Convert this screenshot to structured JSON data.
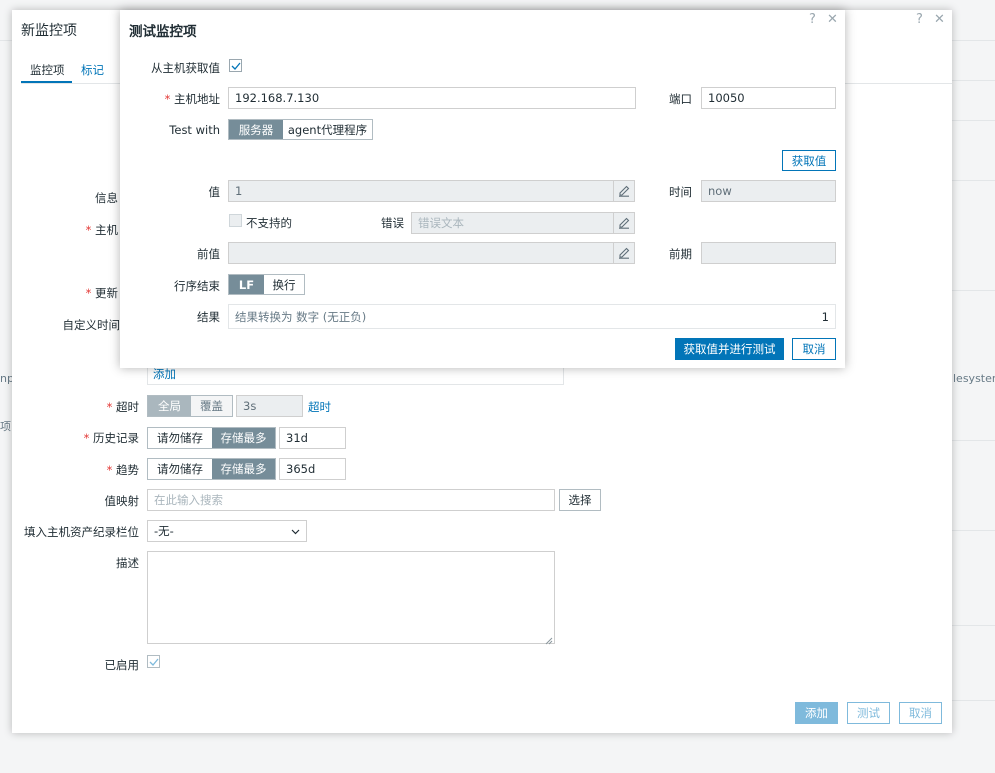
{
  "background": {
    "left_fragments": [
      "npo",
      "项"
    ],
    "right_fragment": "lesystem"
  },
  "item_dialog": {
    "title": "新监控项",
    "help_icon": "?",
    "close_icon": "✕",
    "tabs": [
      {
        "label": "监控项",
        "active": true
      },
      {
        "label": "标记",
        "active": false
      }
    ],
    "field_labels": {
      "info": "信息",
      "host_interface": "主机",
      "update_interval": "更新",
      "custom_intervals": "自定义时间",
      "timeout": "超时",
      "history": "历史记录",
      "trends": "趋势",
      "value_map": "值映射",
      "inventory": "填入主机资产纪录栏位",
      "description": "描述",
      "enabled": "已启用"
    },
    "custom_intervals_add": "添加",
    "timeout": {
      "options": [
        "全局",
        "覆盖"
      ],
      "selected": 0,
      "value": "3s",
      "link": "超时"
    },
    "history": {
      "options": [
        "请勿储存",
        "存储最多"
      ],
      "selected": 1,
      "value": "31d"
    },
    "trends": {
      "options": [
        "请勿储存",
        "存储最多"
      ],
      "selected": 1,
      "value": "365d"
    },
    "value_map": {
      "placeholder": "在此输入搜索",
      "select_label": "选择"
    },
    "inventory": {
      "selected": "-无-"
    },
    "description": {
      "value": ""
    },
    "enabled": {
      "checked": true
    },
    "footer": {
      "add": "添加",
      "test": "测试",
      "cancel": "取消"
    }
  },
  "test_dialog": {
    "title": "测试监控项",
    "help_icon": "?",
    "close_icon": "✕",
    "get_from_host": {
      "label": "从主机获取值",
      "checked": true
    },
    "host_address": {
      "label": "主机地址",
      "value": "192.168.7.130"
    },
    "port": {
      "label": "端口",
      "value": "10050"
    },
    "test_with": {
      "label": "Test with",
      "options": [
        "服务器",
        "agent代理程序"
      ],
      "selected": 0
    },
    "get_value_button": "获取值",
    "value": {
      "label": "值",
      "value": "1"
    },
    "time": {
      "label": "时间",
      "value": "now"
    },
    "not_supported": {
      "label": "不支持的",
      "checked": false
    },
    "error": {
      "label": "错误",
      "placeholder": "错误文本"
    },
    "prev_value": {
      "label": "前值",
      "value": ""
    },
    "prev_time": {
      "label": "前期",
      "value": ""
    },
    "eol": {
      "label": "行序结束",
      "options": [
        "LF",
        "换行"
      ],
      "selected": 0
    },
    "result": {
      "label": "结果",
      "text": "结果转换为 数字 (无正负)",
      "value": "1"
    },
    "buttons": {
      "get_and_test": "获取值并进行测试",
      "cancel": "取消"
    }
  }
}
